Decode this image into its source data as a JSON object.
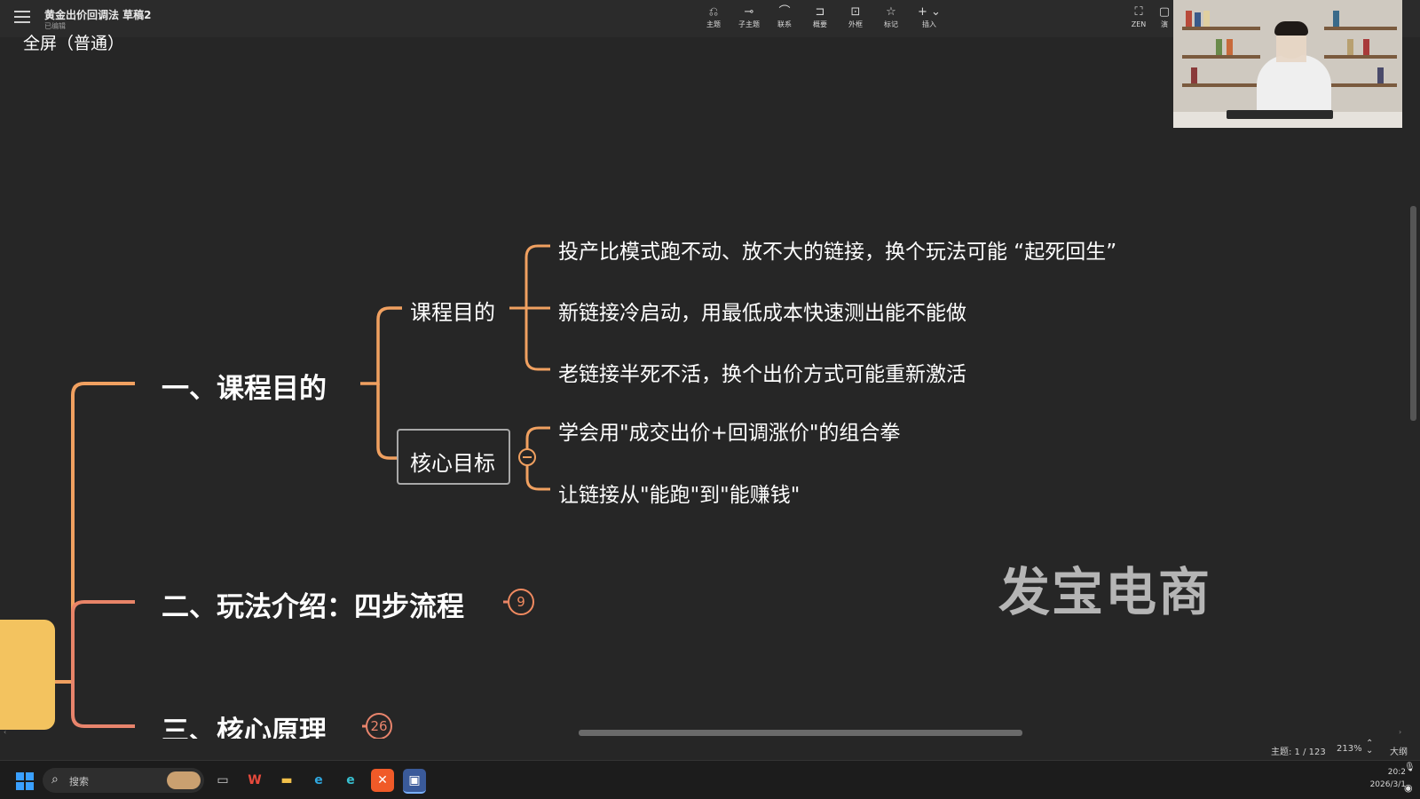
{
  "app": {
    "doc_title": "黄金出价回调法 草稿2",
    "doc_status": "已编辑",
    "fullscreen_label": "全屏（普通）"
  },
  "toolbar": {
    "items": [
      {
        "label": "主题",
        "icon": "topic-icon"
      },
      {
        "label": "子主题",
        "icon": "subtopic-icon"
      },
      {
        "label": "联系",
        "icon": "relationship-icon"
      },
      {
        "label": "概要",
        "icon": "summary-icon"
      },
      {
        "label": "外框",
        "icon": "boundary-icon"
      },
      {
        "label": "标记",
        "icon": "star-icon"
      },
      {
        "label": "插入",
        "icon": "plus-icon"
      }
    ],
    "zen_label": "ZEN",
    "edge_label": "演"
  },
  "mindmap": {
    "branch1": {
      "title": "一、课程目的",
      "sub1": {
        "title": "课程目的",
        "items": [
          "投产比模式跑不动、放不大的链接，换个玩法可能 “起死回生”",
          "新链接冷启动，用最低成本快速测出能不能做",
          "老链接半死不活，换个出价方式可能重新激活"
        ]
      },
      "sub2": {
        "title": "核心目标",
        "items": [
          "学会用\"成交出价+回调涨价\"的组合拳",
          "让链接从\"能跑\"到\"能赚钱\""
        ]
      }
    },
    "branch2": {
      "title": "二、玩法介绍：四步流程",
      "badge": "9"
    },
    "branch3": {
      "title": "三、核心原理",
      "badge": "26"
    }
  },
  "watermark": "发宝电商",
  "status": {
    "topic_count": "主题: 1 / 123",
    "zoom": "213%",
    "outline": "大纲"
  },
  "taskbar": {
    "search_text": "搜索",
    "apps": [
      {
        "name": "task-view",
        "glyph": "▭",
        "color": "#d0d0d0"
      },
      {
        "name": "wps",
        "glyph": "W",
        "color": "#e84a3c"
      },
      {
        "name": "file-explorer",
        "glyph": "▬",
        "color": "#f2c04a"
      },
      {
        "name": "edge",
        "glyph": "e",
        "color": "#2fa8e0"
      },
      {
        "name": "edge-2",
        "glyph": "e",
        "color": "#38c0d0"
      },
      {
        "name": "xmind",
        "glyph": "✕",
        "color": "#f05a28"
      },
      {
        "name": "meeting",
        "glyph": "▣",
        "color": "#4a8cf0"
      }
    ],
    "time": "20:2",
    "date": "2026/3/1"
  },
  "colors": {
    "branch_orange": "#f0a060",
    "branch_coral": "#e88468",
    "root_yellow": "#f3c35f",
    "background": "#262626"
  }
}
